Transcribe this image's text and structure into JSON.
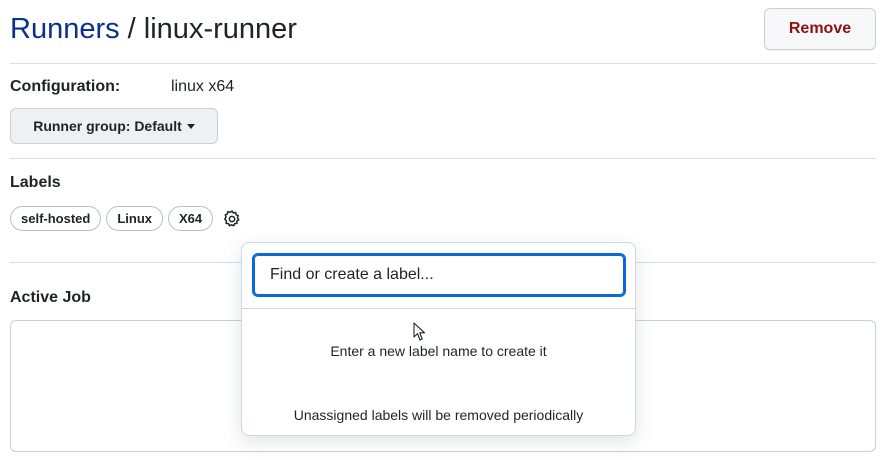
{
  "header": {
    "breadcrumb_root": "Runners",
    "separator": " / ",
    "current": "linux-runner",
    "remove_label": "Remove"
  },
  "configuration": {
    "label": "Configuration:",
    "value": "linux x64"
  },
  "runner_group": {
    "label": "Runner group: Default"
  },
  "labels": {
    "title": "Labels",
    "items": [
      "self-hosted",
      "Linux",
      "X64"
    ],
    "settings_icon": "gear-icon"
  },
  "active_job": {
    "title": "Active Job"
  },
  "label_popover": {
    "placeholder": "Find or create a label...",
    "hint": "Enter a new label name to create it",
    "note": "Unassigned labels will be removed periodically"
  },
  "colors": {
    "link": "#0b2f8c",
    "danger": "#8c1111",
    "focus": "#0969da"
  }
}
